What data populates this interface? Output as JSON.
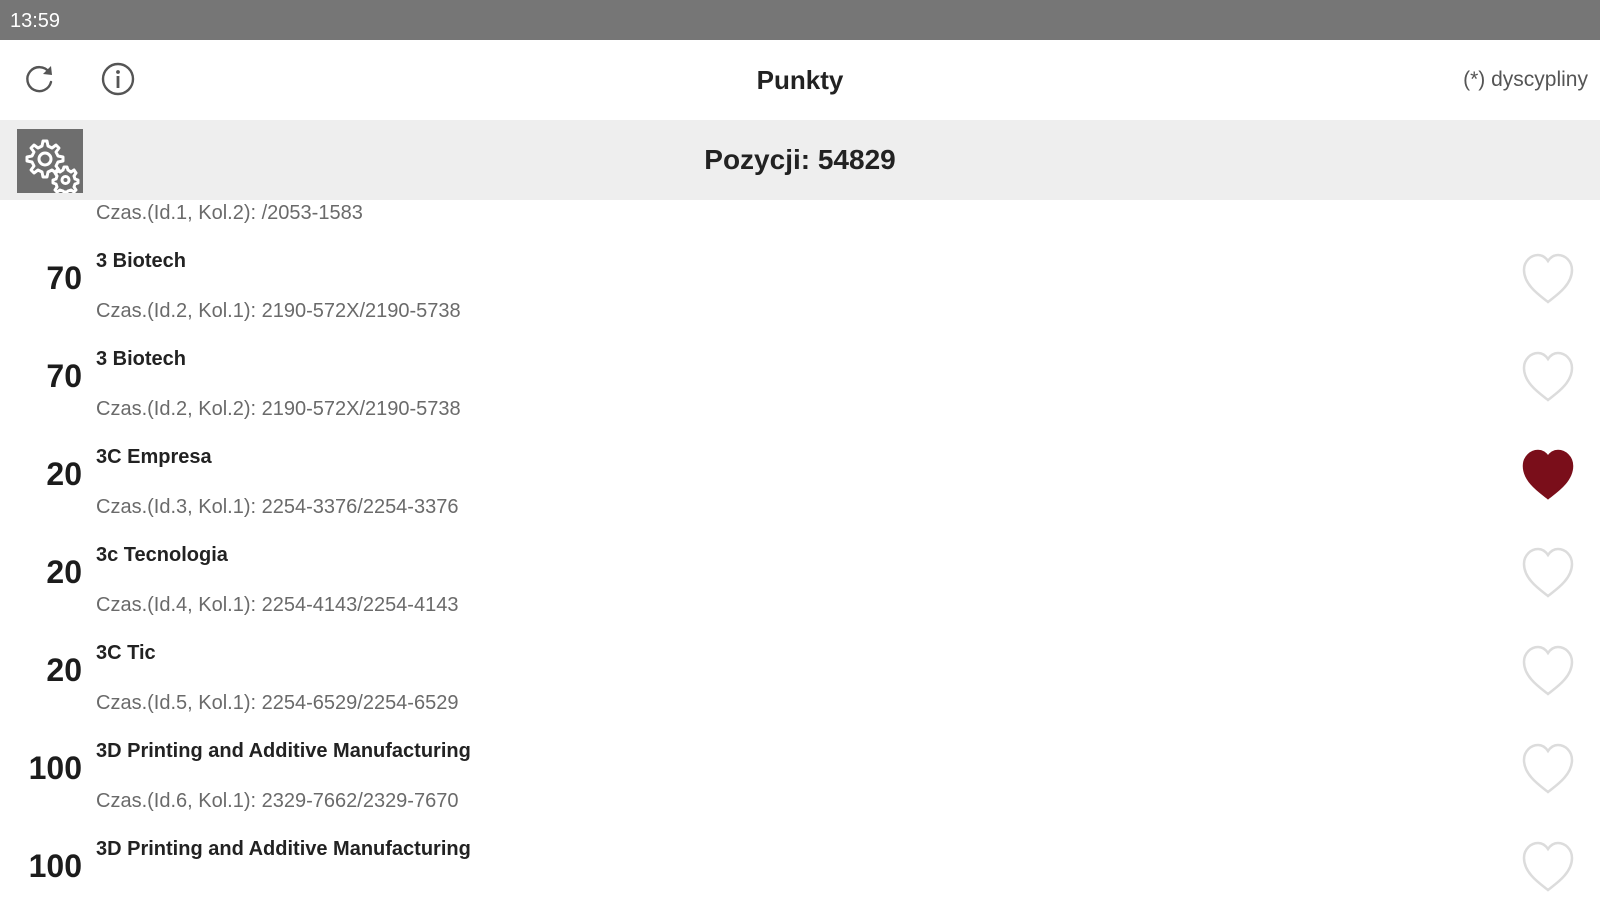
{
  "status_bar": {
    "time": "13:59"
  },
  "app_bar": {
    "title": "Punkty",
    "disciplines_link": "(*) dyscypliny",
    "refresh_icon": "refresh-icon",
    "info_icon": "info-icon"
  },
  "info_bar": {
    "count_text": "Pozycji: 54829",
    "settings_icon": "gears-icon"
  },
  "list": {
    "partial_row": {
      "meta": "Czas.(Id.1, Kol.2): /2053-1583"
    },
    "rows": [
      {
        "points": "70",
        "name": "3 Biotech",
        "meta": "Czas.(Id.2, Kol.1): 2190-572X/2190-5738",
        "favorite": false
      },
      {
        "points": "70",
        "name": "3 Biotech",
        "meta": "Czas.(Id.2, Kol.2): 2190-572X/2190-5738",
        "favorite": false
      },
      {
        "points": "20",
        "name": "3C Empresa",
        "meta": "Czas.(Id.3, Kol.1): 2254-3376/2254-3376",
        "favorite": true
      },
      {
        "points": "20",
        "name": "3c Tecnologia",
        "meta": "Czas.(Id.4, Kol.1): 2254-4143/2254-4143",
        "favorite": false
      },
      {
        "points": "20",
        "name": "3C Tic",
        "meta": "Czas.(Id.5, Kol.1): 2254-6529/2254-6529",
        "favorite": false
      },
      {
        "points": "100",
        "name": "3D Printing and Additive Manufacturing",
        "meta": "Czas.(Id.6, Kol.1): 2329-7662/2329-7670",
        "favorite": false
      },
      {
        "points": "100",
        "name": "3D Printing and Additive Manufacturing",
        "meta": "",
        "favorite": false
      }
    ]
  },
  "colors": {
    "status_bar": "#767676",
    "info_bar": "#eeeeee",
    "favorite_filled": "#7a0e1a",
    "favorite_outline": "#dcdcdc"
  }
}
